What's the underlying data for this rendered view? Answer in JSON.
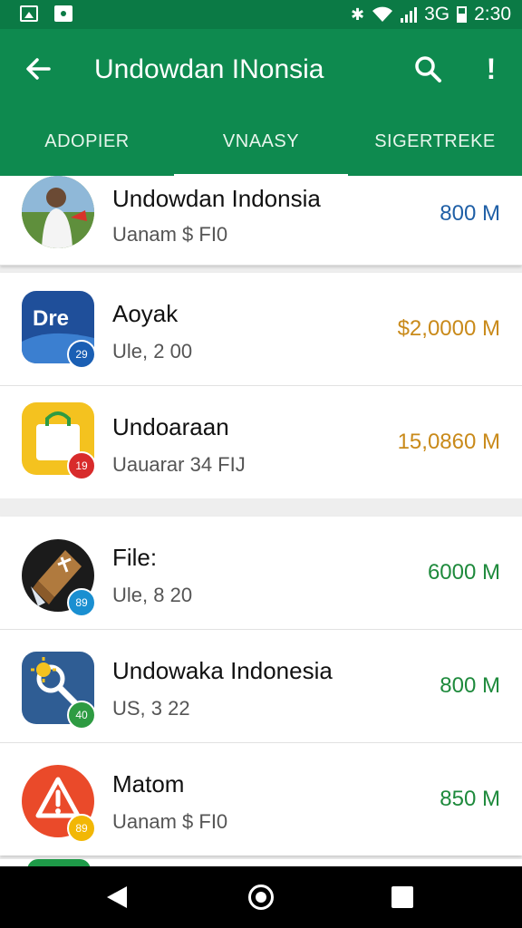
{
  "status_bar": {
    "time": "2:30",
    "signal_text": "3G",
    "icons": [
      "image-icon",
      "notification-icon",
      "bluetooth-icon",
      "wifi-icon",
      "signal-icon",
      "battery-icon"
    ]
  },
  "app_bar": {
    "title": "Undowdan INonsia",
    "back_icon": "arrow-back-icon",
    "search_icon": "search-icon",
    "more_icon": "more-icon",
    "more_glyph": "!"
  },
  "tabs": [
    {
      "label": "ADOPIER",
      "active": false
    },
    {
      "label": "VNAASY",
      "active": true
    },
    {
      "label": "SIGERTREKE",
      "active": false
    }
  ],
  "apps": [
    {
      "name": "Undowdan Indonsia",
      "sub": "Uanam $ FI0",
      "size": "800 M",
      "size_color": "#1f5fa6",
      "icon": "person-photo-icon",
      "badge": ""
    },
    {
      "name": "Aoyak",
      "sub": "Ule, 2 00",
      "size": "$2,0000 M",
      "size_color": "#c98a1a",
      "icon": "document-app-icon",
      "icon_text": "Dre",
      "badge": "29",
      "badge_color": "#1a5fb4"
    },
    {
      "name": "Undoaraan",
      "sub": "Uauarar 34 FIJ",
      "size": "15,0860 M",
      "size_color": "#c98a1a",
      "icon": "shopping-bag-icon",
      "badge": "19",
      "badge_color": "#d82b2b"
    },
    {
      "name": "File:",
      "sub": "Ule, 8 20",
      "size": "6000 M",
      "size_color": "#1e8a3c",
      "icon": "package-icon",
      "badge": "89",
      "badge_color": "#1a8fd1"
    },
    {
      "name": "Undowaka Indonesia",
      "sub": "US, 3 22",
      "size": "800 M",
      "size_color": "#1e8a3c",
      "icon": "search-sun-icon",
      "badge": "40",
      "badge_color": "#2e9b42"
    },
    {
      "name": "Matom",
      "sub": "Uanam $ FI0",
      "size": "850 M",
      "size_color": "#1e8a3c",
      "icon": "warning-icon",
      "badge": "89",
      "badge_color": "#f2b705"
    }
  ],
  "nav_bar": {
    "icons": [
      "nav-back-icon",
      "nav-home-icon",
      "nav-recent-icon"
    ]
  }
}
